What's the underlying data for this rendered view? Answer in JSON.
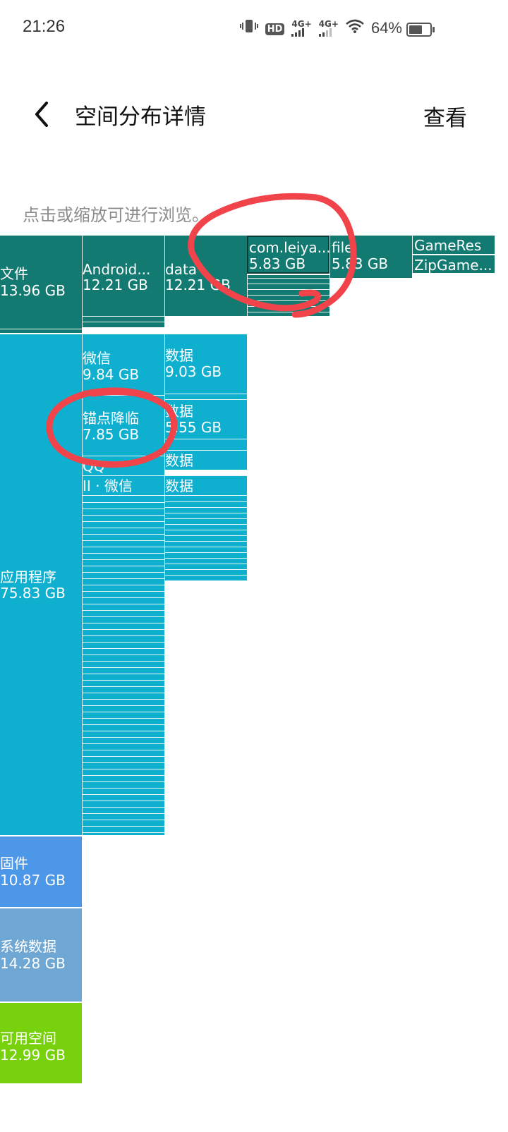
{
  "status_bar": {
    "time": "21:26",
    "hd_badge": "HD",
    "hd_sub": "1\n2",
    "net1": "4G+",
    "net2": "4G+",
    "battery_text": "64%",
    "battery_level": 0.64,
    "icons": [
      "vibrate-icon",
      "hd-icon",
      "signal-icon",
      "signal-icon",
      "wifi-icon",
      "battery-icon"
    ]
  },
  "header": {
    "title": "空间分布详情",
    "view_label": "查看"
  },
  "hint": "点击或缩放可进行浏览。",
  "treemap": {
    "files": {
      "name": "文件",
      "size": "13.96 GB"
    },
    "android": {
      "name": "Android...",
      "size": "12.21 GB"
    },
    "data": {
      "name": "data",
      "size": "12.21 GB"
    },
    "com": {
      "name": "com.leiya...",
      "size": "5.83 GB"
    },
    "file": {
      "name": "file",
      "size": "5.83 GB"
    },
    "gameres": {
      "name": "GameRes"
    },
    "zipgame": {
      "name": "ZipGame..."
    },
    "apps": {
      "name": "应用程序",
      "size": "75.83 GB"
    },
    "wechat": {
      "name": "微信",
      "size": "9.84 GB"
    },
    "wechat_data": {
      "name": "数据",
      "size": "9.03 GB"
    },
    "anchor": {
      "name": "锚点降临",
      "size": "7.85 GB"
    },
    "anchor_data": {
      "name": "数据",
      "size": "5.55 GB"
    },
    "qq": {
      "name": "QQ"
    },
    "qq_data": {
      "name": "数据"
    },
    "wechat2": {
      "name": "II · 微信"
    },
    "wechat2_data": {
      "name": "数据"
    },
    "firmware": {
      "name": "固件",
      "size": "10.87 GB"
    },
    "sysdata": {
      "name": "系统数据",
      "size": "14.28 GB"
    },
    "free": {
      "name": "可用空间",
      "size": "12.99 GB"
    }
  },
  "colors": {
    "files": "#137a72",
    "apps": "#0fb0cf",
    "firmware": "#4d97e9",
    "sysdata": "#6ea6d4",
    "free": "#78d10d",
    "annotation": "#f0444a"
  }
}
